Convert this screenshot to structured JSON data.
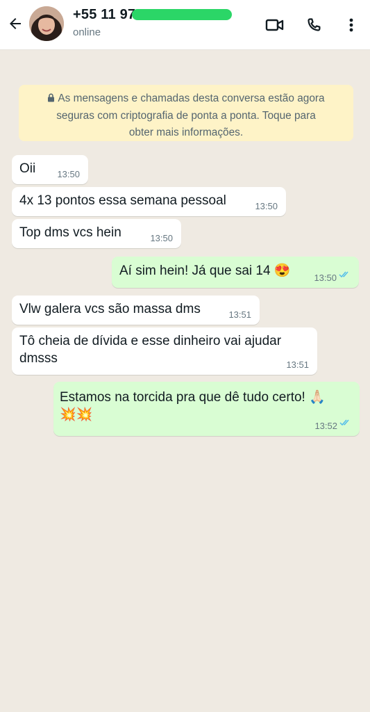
{
  "header": {
    "contact_name": "+55 11 97",
    "status": "online"
  },
  "encryption_notice": {
    "line1": "As mensagens e chamadas desta conversa estão agora",
    "line2": "seguras com criptografia de ponta a ponta. Toque para",
    "line3": "obter mais informações."
  },
  "messages": [
    {
      "direction": "in",
      "text": "Oii",
      "time": "13:50"
    },
    {
      "direction": "in",
      "text": "4x 13 pontos essa semana pessoal",
      "time": "13:50"
    },
    {
      "direction": "in",
      "text": "Top dms vcs hein",
      "time": "13:50"
    },
    {
      "direction": "out",
      "text": "Aí sim hein! Já que sai 14 😍",
      "time": "13:50",
      "status": "read"
    },
    {
      "direction": "in",
      "text": "Vlw galera vcs são massa dms",
      "time": "13:51"
    },
    {
      "direction": "in",
      "line1": "Tô cheia de dívida e esse dinheiro vai ajudar",
      "line2": "dmsss",
      "time": "13:51"
    },
    {
      "direction": "out",
      "line1": "Estamos na torcida pra que dê tudo certo! 🙏🏻",
      "line2": "💥💥",
      "time": "13:52",
      "status": "read"
    }
  ],
  "colors": {
    "chat_background": "#efeae2",
    "incoming_bubble": "#ffffff",
    "outgoing_bubble": "#d9fdd3",
    "notice_background": "#fef3c7",
    "read_ticks": "#53bdeb"
  },
  "icons": [
    "back-arrow-icon",
    "video-call-icon",
    "phone-icon",
    "more-options-icon",
    "lock-icon",
    "double-check-icon"
  ]
}
